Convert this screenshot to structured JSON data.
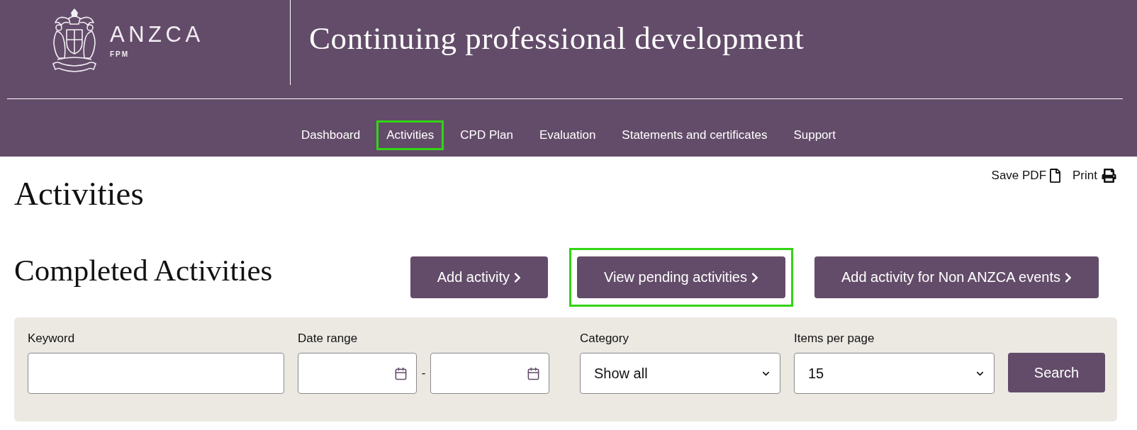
{
  "header": {
    "logo": {
      "wordmark": "ANZCA",
      "subtitle": "FPM"
    },
    "title": "Continuing professional development",
    "nav": [
      {
        "label": "Dashboard",
        "highlighted": false
      },
      {
        "label": "Activities",
        "highlighted": true
      },
      {
        "label": "CPD Plan",
        "highlighted": false
      },
      {
        "label": "Evaluation",
        "highlighted": false
      },
      {
        "label": "Statements and certificates",
        "highlighted": false
      },
      {
        "label": "Support",
        "highlighted": false
      }
    ]
  },
  "toolbar": [
    {
      "kind": "pdf",
      "label": "Save PDF"
    },
    {
      "kind": "print",
      "label": "Print"
    }
  ],
  "page_title": "Activities",
  "section": {
    "title": "Completed Activities",
    "buttons": [
      {
        "label": "Add activity",
        "highlighted": false
      },
      {
        "label": "View pending activities",
        "highlighted": true
      },
      {
        "label": "Add activity for Non ANZCA events",
        "highlighted": false
      }
    ]
  },
  "filters": {
    "fields": [
      {
        "kind": "text",
        "label": "Keyword"
      },
      {
        "kind": "date_range",
        "label": "Date range",
        "separator": "-"
      },
      {
        "kind": "select",
        "label": "Category",
        "value": "Show all"
      },
      {
        "kind": "select",
        "label": "Items per page",
        "value": "15"
      }
    ],
    "submit": "Search"
  }
}
